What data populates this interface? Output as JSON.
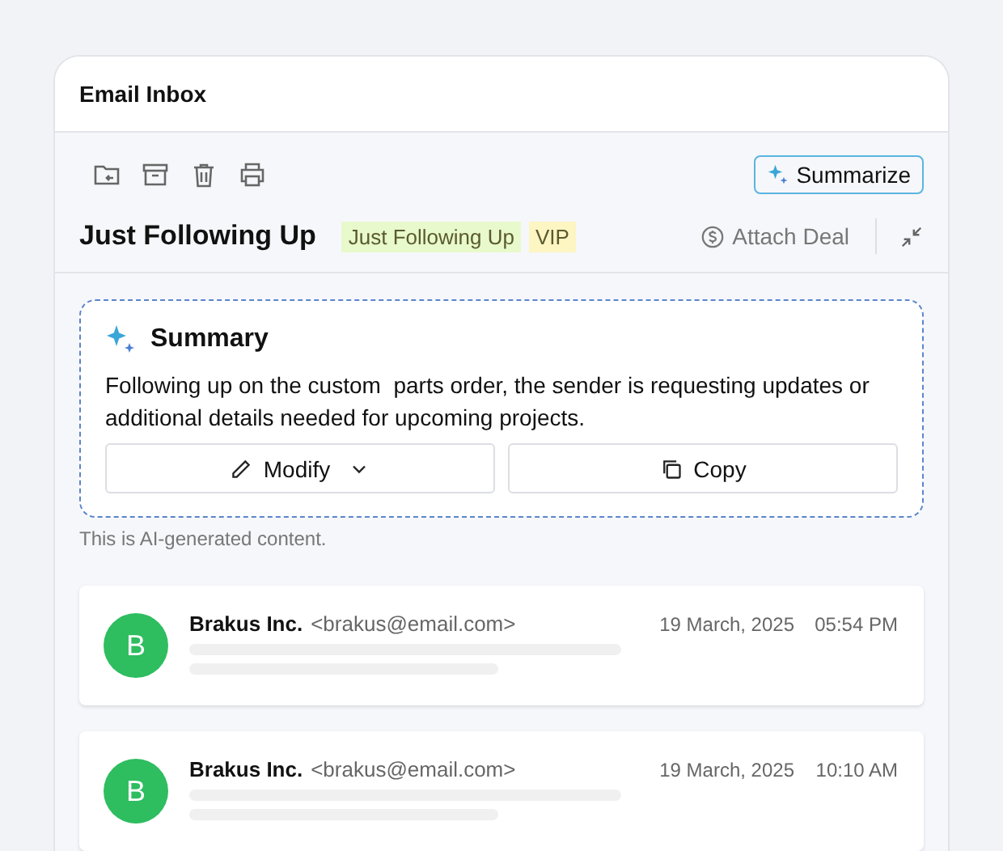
{
  "window": {
    "title": "Email Inbox"
  },
  "toolbar": {
    "summarize_button": "Summarize"
  },
  "message": {
    "subject": "Just Following Up",
    "tags": [
      {
        "label": "Just Following Up",
        "color": "#e8f9cc"
      },
      {
        "label": "VIP",
        "color": "#fdf5c2"
      }
    ],
    "attach_deal": "Attach Deal"
  },
  "summary": {
    "title": "Summary",
    "text": "Following up on the custom  parts order, the sender is requesting updates or additional details needed for upcoming projects.",
    "modify_button": "Modify",
    "copy_button": "Copy",
    "disclaimer": "This is AI-generated content."
  },
  "emails": [
    {
      "avatar": "B",
      "sender": "Brakus Inc.",
      "address": "<brakus@email.com>",
      "date": "19 March, 2025",
      "time": "05:54 PM"
    },
    {
      "avatar": "B",
      "sender": "Brakus Inc.",
      "address": "<brakus@email.com>",
      "date": "19 March, 2025",
      "time": "10:10 AM"
    }
  ]
}
